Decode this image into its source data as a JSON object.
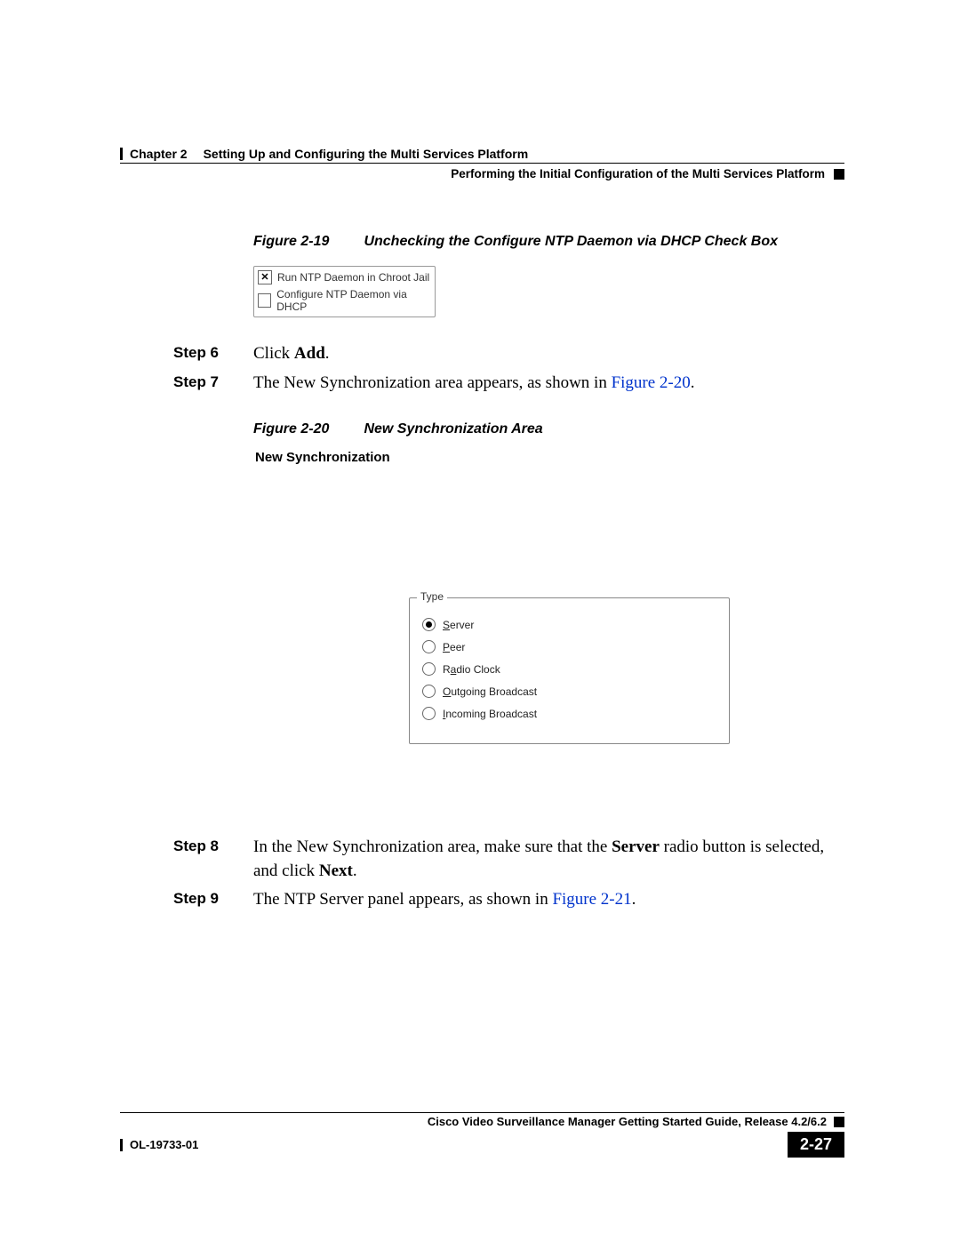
{
  "header": {
    "chapter_label": "Chapter 2",
    "chapter_title": "Setting Up and Configuring the Multi Services Platform",
    "section_title": "Performing the Initial Configuration of the Multi Services Platform"
  },
  "figure_19": {
    "number": "Figure 2-19",
    "title": "Unchecking the Configure NTP Daemon via DHCP Check Box",
    "checkbox_1_label": "Run NTP Daemon in Chroot Jail",
    "checkbox_2_label": "Configure NTP Daemon via DHCP"
  },
  "steps": {
    "s6_label": "Step 6",
    "s6_text_pre": "Click ",
    "s6_text_bold": "Add",
    "s6_text_post": ".",
    "s7_label": "Step 7",
    "s7_text_pre": "The New Synchronization area appears, as shown in ",
    "s7_link": "Figure 2-20",
    "s7_text_post": ".",
    "s8_label": "Step 8",
    "s8_text_pre": "In the New Synchronization area, make sure that the ",
    "s8_bold1": "Server",
    "s8_mid": " radio button is selected, and click ",
    "s8_bold2": "Next",
    "s8_text_post": ".",
    "s9_label": "Step 9",
    "s9_text_pre": "The NTP Server panel appears, as shown in ",
    "s9_link": "Figure 2-21",
    "s9_text_post": "."
  },
  "figure_20": {
    "number": "Figure 2-20",
    "title": "New Synchronization Area",
    "panel_title": "New Synchronization",
    "type_legend": "Type",
    "radio_server": "erver",
    "radio_peer": "eer",
    "radio_radio_clock_pre": "R",
    "radio_radio_clock_u": "a",
    "radio_radio_clock_post": "dio Clock",
    "radio_outgoing": "utgoing Broadcast",
    "radio_incoming": "ncoming Broadcast"
  },
  "footer": {
    "guide_title": "Cisco Video Surveillance Manager Getting Started Guide, Release 4.2/6.2",
    "doc_id": "OL-19733-01",
    "page_number": "2-27"
  }
}
